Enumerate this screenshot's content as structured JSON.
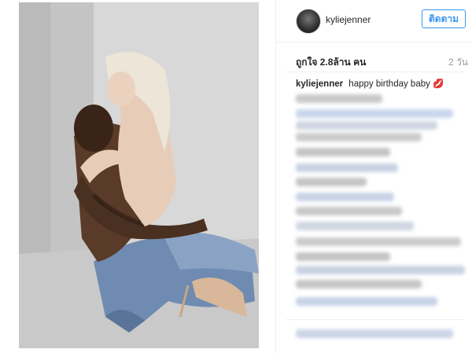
{
  "post": {
    "username": "kyliejenner",
    "follow_label": "ติดตาม",
    "likes": "ถูกใจ 2.8ล้าน คน",
    "time": "2 วัน",
    "caption_user": "kyliejenner",
    "caption_text": "happy birthday baby 💋"
  },
  "icons": {
    "avatar": "profile-avatar-icon"
  },
  "colors": {
    "accent": "#3897f0",
    "text": "#262626",
    "muted": "#999999"
  }
}
